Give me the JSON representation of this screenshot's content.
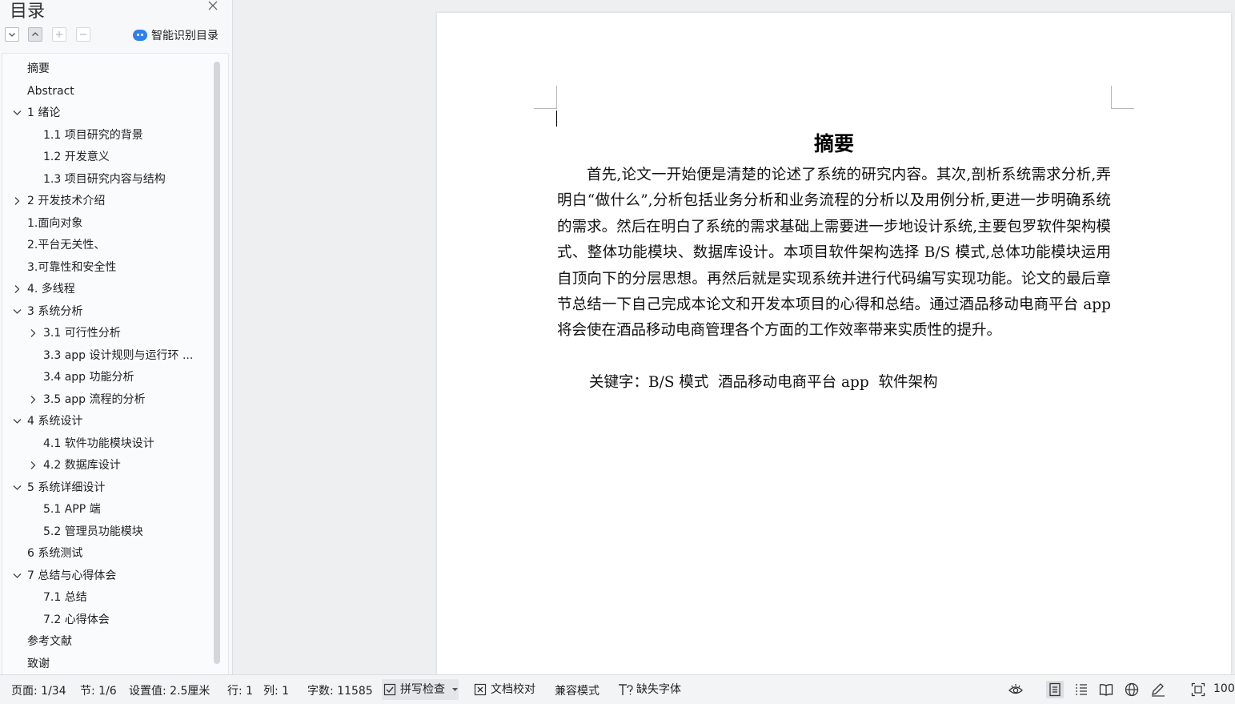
{
  "toc": {
    "title": "目录",
    "ai_label": "智能识别目录",
    "items": [
      {
        "label": "摘要",
        "level": 0,
        "expander": "none"
      },
      {
        "label": "Abstract",
        "level": 0,
        "expander": "none"
      },
      {
        "label": "1 绪论",
        "level": 0,
        "expander": "expanded"
      },
      {
        "label": "1.1 项目研究的背景",
        "level": 1,
        "expander": "none"
      },
      {
        "label": "1.2 开发意义",
        "level": 1,
        "expander": "none"
      },
      {
        "label": "1.3 项目研究内容与结构",
        "level": 1,
        "expander": "none"
      },
      {
        "label": "2 开发技术介绍",
        "level": 0,
        "expander": "collapsed"
      },
      {
        "label": "1.面向对象",
        "level": 0,
        "expander": "none"
      },
      {
        "label": "2.平台无关性、",
        "level": 0,
        "expander": "none"
      },
      {
        "label": "3.可靠性和安全性",
        "level": 0,
        "expander": "none"
      },
      {
        "label": "4.  多线程",
        "level": 0,
        "expander": "collapsed"
      },
      {
        "label": "3 系统分析",
        "level": 0,
        "expander": "expanded"
      },
      {
        "label": "3.1 可行性分析",
        "level": 1,
        "expander": "collapsed"
      },
      {
        "label": "3.3 app 设计规则与运行环 ...",
        "level": 1,
        "expander": "none"
      },
      {
        "label": "3.4 app 功能分析",
        "level": 1,
        "expander": "none"
      },
      {
        "label": "3.5 app 流程的分析",
        "level": 1,
        "expander": "collapsed"
      },
      {
        "label": "4 系统设计",
        "level": 0,
        "expander": "expanded"
      },
      {
        "label": "4.1  软件功能模块设计",
        "level": 1,
        "expander": "none"
      },
      {
        "label": "4.2  数据库设计",
        "level": 1,
        "expander": "collapsed"
      },
      {
        "label": "5 系统详细设计",
        "level": 0,
        "expander": "expanded"
      },
      {
        "label": "5.1 APP 端",
        "level": 1,
        "expander": "none"
      },
      {
        "label": "5.2 管理员功能模块",
        "level": 1,
        "expander": "none"
      },
      {
        "label": "6 系统测试",
        "level": 0,
        "expander": "none"
      },
      {
        "label": "7 总结与心得体会",
        "level": 0,
        "expander": "expanded"
      },
      {
        "label": "7.1  总结",
        "level": 1,
        "expander": "none"
      },
      {
        "label": "7.2  心得体会",
        "level": 1,
        "expander": "none"
      },
      {
        "label": "参考文献",
        "level": 0,
        "expander": "none"
      },
      {
        "label": "致谢",
        "level": 0,
        "expander": "none"
      }
    ]
  },
  "document": {
    "heading": "摘要",
    "body": "首先,论文一开始便是清楚的论述了系统的研究内容。其次,剖析系统需求分析,弄明白“做什么”,分析包括业务分析和业务流程的分析以及用例分析,更进一步明确系统的需求。然后在明白了系统的需求基础上需要进一步地设计系统,主要包罗软件架构模式、整体功能模块、数据库设计。本项目软件架构选择 B/S 模式,总体功能模块运用自顶向下的分层思想。再然后就是实现系统并进行代码编写实现功能。论文的最后章节总结一下自己完成本论文和开发本项目的心得和总结。通过酒品移动电商平台 app 将会使在酒品移动电商管理各个方面的工作效率带来实质性的提升。",
    "keywords": "关键字：B/S 模式  酒品移动电商平台 app  软件架构"
  },
  "statusbar": {
    "page": "页面: 1/34",
    "section": "节: 1/6",
    "setting": "设置值: 2.5厘米",
    "row": "行: 1",
    "col": "列: 1",
    "wordcount": "字数: 11585",
    "spellcheck": "拼写检查",
    "proofread": "文档校对",
    "compat": "兼容模式",
    "missing_font": "缺失字体",
    "zoom": "100"
  },
  "colors": {
    "accent": "#2f80ed",
    "panel": "#f7f8fa",
    "page": "#ffffff",
    "workspace": "#eeeff1"
  }
}
